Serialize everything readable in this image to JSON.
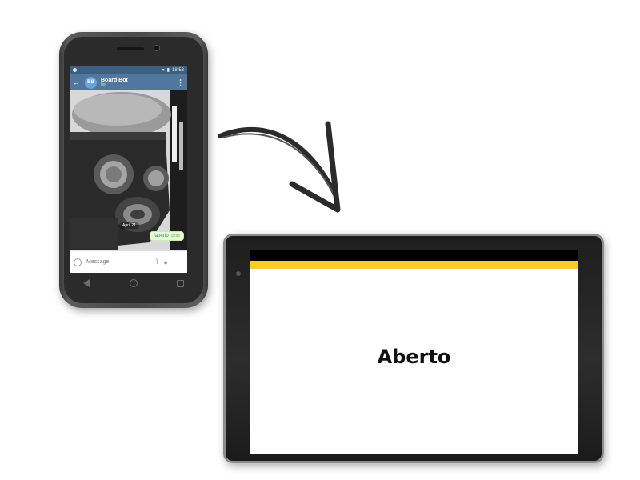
{
  "phone": {
    "status_bar": {
      "time": "18:53"
    },
    "chat_header": {
      "back_icon": "back-arrow-icon",
      "avatar_initials": "BB",
      "title": "Board Bot",
      "subtitle": "bot",
      "menu_icon": "more-vert-icon"
    },
    "chat": {
      "date": "April 21",
      "message": {
        "text": "/aberto",
        "time": "18:52"
      }
    },
    "input": {
      "placeholder": "Message",
      "emoji_icon": "smile-icon",
      "attach_icon": "paperclip-icon",
      "mic_icon": "mic-icon"
    },
    "nav": [
      "back-icon",
      "home-icon",
      "recents-icon"
    ]
  },
  "tablet": {
    "status_text": "Aberto",
    "accent_color": "#f8cb2e"
  }
}
